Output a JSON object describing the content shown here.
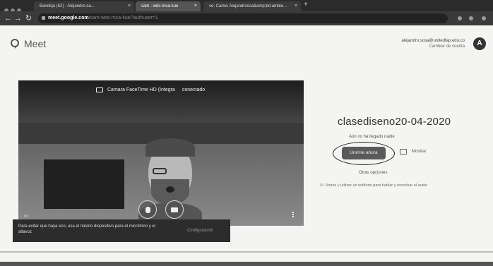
{
  "browser": {
    "tabs": [
      {
        "title": "Bandeja (62) - Alejandro.sa..."
      },
      {
        "title": "sam - wds-mca-kue"
      },
      {
        "title": "ve: Carlos Alejandrossa&amp;bd.ambie..."
      }
    ],
    "url_host": "meet.google.com",
    "url_path": "/sam-wds-mca-kue?authuser=1"
  },
  "header": {
    "app_name": "Meet",
    "account_email": "alejandro.sosa@unitedfap.edu.co",
    "switch_account": "Cambiar de cuenta",
    "avatar_letter": "A"
  },
  "preview": {
    "camera_name": "Camara FaceTime HD (Integra",
    "camera_status": "conectado",
    "corner_label": "Ifd"
  },
  "tooltip": {
    "message": "Para evitar que haya eco, usa el mismo dispositivo para el micrófono y el altavoz",
    "config": "Configuración"
  },
  "join": {
    "meeting_title": "clasediseno20-04-2020",
    "status": "Aún no ha llegado nadie",
    "join_button": "Unirme ahora",
    "present_button": "Mostrar",
    "other_options": "Otras opciones",
    "phone_option": "Unirse y utilizar un teléfono para hablar y escuchar el audio"
  }
}
